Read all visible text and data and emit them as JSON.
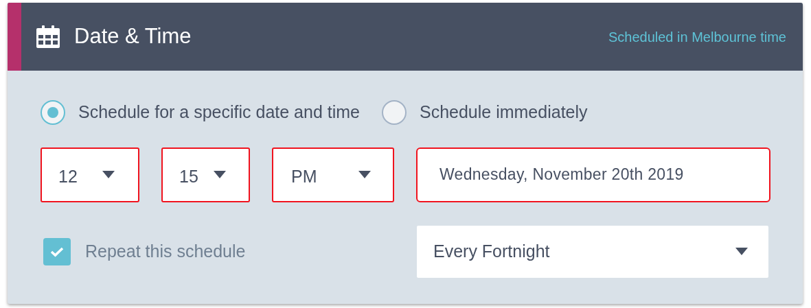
{
  "header": {
    "title": "Date & Time",
    "note": "Scheduled in Melbourne time"
  },
  "schedule_options": [
    {
      "label": "Schedule for a specific date and time",
      "selected": true
    },
    {
      "label": "Schedule immediately",
      "selected": false
    }
  ],
  "time_fields": [
    {
      "value": "12",
      "invalid": true
    },
    {
      "value": "15",
      "invalid": true
    },
    {
      "value": "PM",
      "invalid": true
    }
  ],
  "date_field": {
    "value": "Wednesday, November 20th 2019",
    "invalid": true
  },
  "repeat": {
    "label": "Repeat this schedule",
    "checked": true
  },
  "frequency": {
    "value": "Every Fortnight",
    "invalid": false
  }
}
